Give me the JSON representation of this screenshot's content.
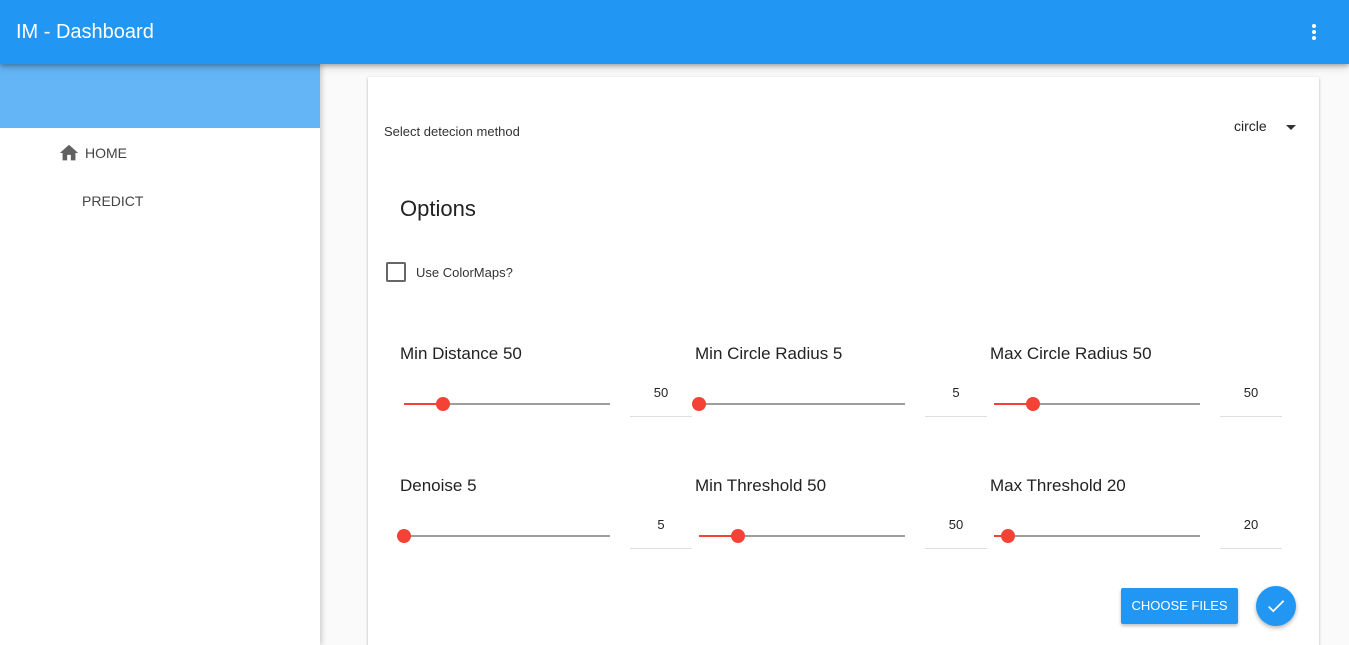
{
  "app": {
    "title": "IM - Dashboard"
  },
  "sidebar": {
    "items": [
      {
        "label": "HOME",
        "icon": "home-icon"
      },
      {
        "label": "PREDICT"
      }
    ]
  },
  "form": {
    "method_label": "Select detecion method",
    "method_value": "circle",
    "options_title": "Options",
    "colormaps_label": "Use ColorMaps?",
    "colormaps_checked": false,
    "sliders": [
      {
        "label": "Min Distance 50",
        "value": "50",
        "fraction": 0.19
      },
      {
        "label": "Min Circle Radius 5",
        "value": "5",
        "fraction": 0.0
      },
      {
        "label": "Max Circle Radius 50",
        "value": "50",
        "fraction": 0.19
      },
      {
        "label": "Denoise 5",
        "value": "5",
        "fraction": 0.0
      },
      {
        "label": "Min Threshold 50",
        "value": "50",
        "fraction": 0.19
      },
      {
        "label": "Max Threshold 20",
        "value": "20",
        "fraction": 0.07
      }
    ],
    "choose_files_label": "CHOOSE FILES"
  },
  "colors": {
    "primary": "#2196f3",
    "drawer_header": "#64b5f6",
    "slider_accent": "#f44336"
  }
}
